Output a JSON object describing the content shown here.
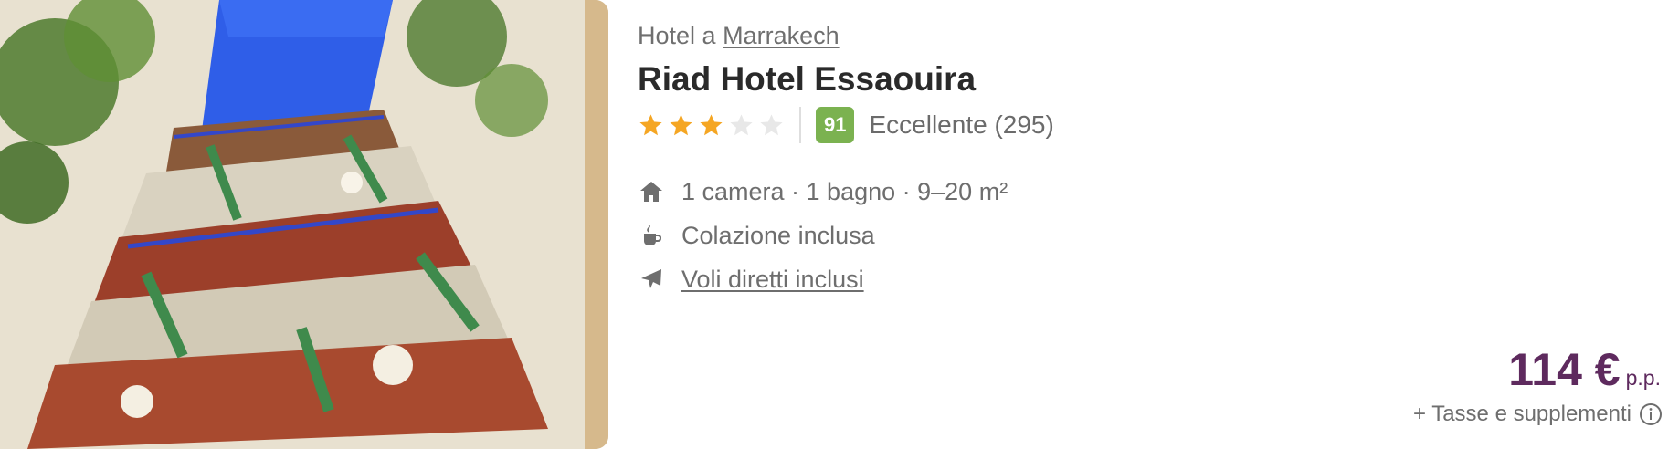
{
  "location": {
    "prefix": "Hotel a",
    "city": "Marrakech"
  },
  "hotel": {
    "name": "Riad Hotel Essaouira",
    "stars_filled": 3,
    "stars_total": 5
  },
  "review": {
    "score": "91",
    "label": "Eccellente (295)"
  },
  "features": [
    {
      "icon": "home-icon",
      "text": "1 camera · 1 bagno · 9–20 m²"
    },
    {
      "icon": "coffee-cup-icon",
      "text": "Colazione inclusa"
    },
    {
      "icon": "plane-icon",
      "text": "Voli diretti inclusi"
    }
  ],
  "price": {
    "amount": "114 €",
    "unit": "p.p.",
    "taxes": "+ Tasse e supplementi"
  },
  "colors": {
    "star_active": "#f5a623",
    "star_inactive": "#e8e8e8",
    "score_bg": "#7bb250",
    "price": "#5e2a5e"
  }
}
